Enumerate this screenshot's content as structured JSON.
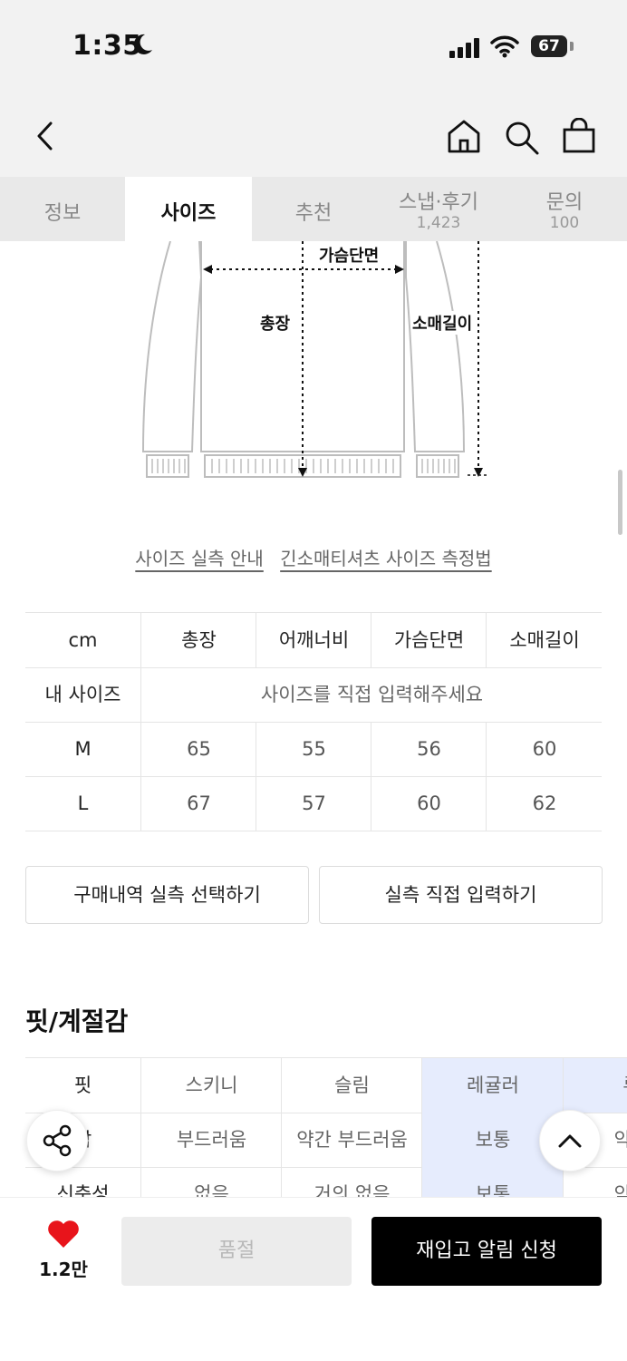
{
  "status": {
    "time": "1:35",
    "battery": "67"
  },
  "tabs": [
    {
      "label": "정보",
      "count": ""
    },
    {
      "label": "사이즈",
      "count": ""
    },
    {
      "label": "추천",
      "count": ""
    },
    {
      "label": "스냅·후기",
      "count": "1,423"
    },
    {
      "label": "문의",
      "count": "100"
    }
  ],
  "diagram": {
    "chest": "가슴단면",
    "length": "총장",
    "sleeve": "소매길이"
  },
  "links": {
    "guide": "사이즈 실측 안내",
    "method": "긴소매티셔츠 사이즈 측정법"
  },
  "size_table": {
    "headers": [
      "cm",
      "총장",
      "어깨너비",
      "가슴단면",
      "소매길이"
    ],
    "my_size_label": "내 사이즈",
    "my_size_prompt": "사이즈를 직접 입력해주세요",
    "rows": [
      {
        "size": "M",
        "values": [
          "65",
          "55",
          "56",
          "60"
        ]
      },
      {
        "size": "L",
        "values": [
          "67",
          "57",
          "60",
          "62"
        ]
      }
    ]
  },
  "buttons": {
    "purchase_history": "구매내역 실측 선택하기",
    "direct_input": "실측 직접 입력하기"
  },
  "fit_section": {
    "title": "핏/계절감",
    "rows": [
      {
        "label": "핏",
        "options": [
          "스키니",
          "슬림",
          "레귤러",
          "루"
        ]
      },
      {
        "label": "감",
        "options": [
          "부드러움",
          "약간 부드러움",
          "보통",
          "약간"
        ]
      },
      {
        "label": "신축성",
        "options": [
          "없음",
          "거의 없음",
          "보통",
          "약간"
        ]
      }
    ]
  },
  "bottom": {
    "likes": "1.2만",
    "soldout": "품절",
    "notify": "재입고 알림 신청"
  },
  "colors": {
    "highlight": "#e6ecfd",
    "like": "#e8141b"
  }
}
